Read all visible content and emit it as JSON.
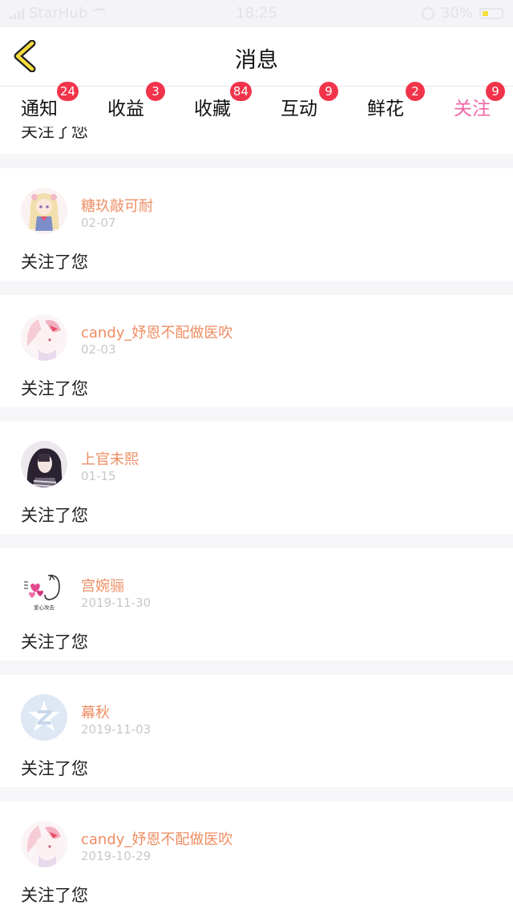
{
  "status_bar": {
    "carrier": "StarHub",
    "time": "18:25",
    "battery": "30%"
  },
  "nav": {
    "title": "消息"
  },
  "tabs": [
    {
      "label": "通知",
      "badge": "24"
    },
    {
      "label": "收益",
      "badge": "3"
    },
    {
      "label": "收藏",
      "badge": "84"
    },
    {
      "label": "互动",
      "badge": "9"
    },
    {
      "label": "鲜花",
      "badge": "2"
    },
    {
      "label": "关注",
      "badge": "9",
      "active": true
    }
  ],
  "clipped_item": {
    "text": "关注了您"
  },
  "messages": [
    {
      "name": "糖玖敲可耐",
      "date": "02-07",
      "text": "关注了您",
      "avatar_icon": "anime-girl-avatar-icon"
    },
    {
      "name": "candy_妤恩不配做医吹",
      "date": "02-03",
      "text": "关注了您",
      "avatar_icon": "anime-fox-avatar-icon"
    },
    {
      "name": "上官未熙",
      "date": "01-15",
      "text": "关注了您",
      "avatar_icon": "dark-hair-girl-avatar-icon"
    },
    {
      "name": "宫婉骊",
      "date": "2019-11-30",
      "text": "关注了您",
      "avatar_icon": "heart-cat-sticker-avatar-icon",
      "avatar_text": "爱心攻击"
    },
    {
      "name": "幕秋",
      "date": "2019-11-03",
      "text": "关注了您",
      "avatar_icon": "qq-default-avatar-icon"
    },
    {
      "name": "candy_妤恩不配做医吹",
      "date": "2019-10-29",
      "text": "关注了您",
      "avatar_icon": "anime-fox-avatar-icon"
    }
  ],
  "colors": {
    "accent_pink": "#f066a7",
    "badge_red": "#f1344b",
    "name_orange": "#ee8d63",
    "back_yellow": "#f5dc3c"
  }
}
